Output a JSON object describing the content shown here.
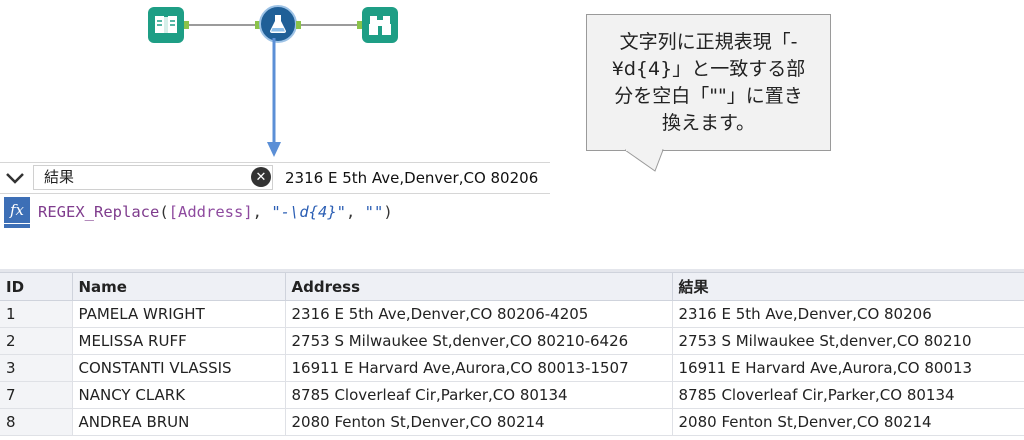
{
  "workflow": {
    "tools": [
      {
        "name": "input-data-tool",
        "icon": "book-icon"
      },
      {
        "name": "formula-tool",
        "icon": "flask-icon"
      },
      {
        "name": "browse-tool",
        "icon": "binoculars-icon"
      }
    ]
  },
  "callout": {
    "lines": [
      "文字列に正規表現「-",
      "¥d{4}」と一致する部",
      "分を空白「\"\"」に置き",
      "換えます。"
    ]
  },
  "config": {
    "output_field": "結果",
    "preview_value": "2316 E 5th Ave,Denver,CO 80206",
    "expression": {
      "fn": "REGEX_Replace",
      "open": "(",
      "field": "[Address]",
      "sep1": ", ",
      "pattern": "\"-\\d{4}\"",
      "sep2": ", ",
      "replacement": "\"\"",
      "close": ")"
    }
  },
  "table": {
    "columns": [
      "ID",
      "Name",
      "Address",
      "結果"
    ],
    "rows": [
      [
        "1",
        "PAMELA WRIGHT",
        "2316 E 5th Ave,Denver,CO 80206-4205",
        "2316 E 5th Ave,Denver,CO 80206"
      ],
      [
        "2",
        "MELISSA RUFF",
        "2753 S Milwaukee St,denver,CO 80210-6426",
        "2753 S Milwaukee St,denver,CO 80210"
      ],
      [
        "3",
        "CONSTANTI VLASSIS",
        "16911 E Harvard Ave,Aurora,CO 80013-1507",
        "16911 E Harvard Ave,Aurora,CO 80013"
      ],
      [
        "7",
        "NANCY CLARK",
        "8785 Cloverleaf Cir,Parker,CO 80134",
        "8785 Cloverleaf Cir,Parker,CO 80134"
      ],
      [
        "8",
        "ANDREA BRUN",
        "2080 Fenton St,Denver,CO 80214",
        "2080 Fenton St,Denver,CO 80214"
      ]
    ]
  },
  "colors": {
    "tool_green": "#1e9e85",
    "tool_blue": "#1f5f97",
    "connection_blue": "#5b8fd6",
    "anchor_green": "#8bc34a"
  }
}
